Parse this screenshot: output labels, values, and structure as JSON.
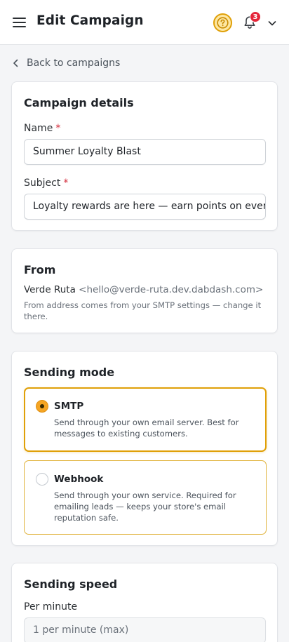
{
  "header": {
    "title": "Edit Campaign",
    "notification_count": "3",
    "icons": [
      "hamburger-menu-icon",
      "help-icon",
      "bell-icon",
      "chevron-down-icon"
    ],
    "accent_color": "#e0a008",
    "badge_color": "#e5263a"
  },
  "nav": {
    "back_label": "Back to campaigns"
  },
  "campaign_details": {
    "title": "Campaign details",
    "name_label": "Name",
    "name_value": "Summer Loyalty Blast",
    "subject_label": "Subject",
    "subject_value": "Loyalty rewards are here — earn points on every",
    "required_mark": "*"
  },
  "from": {
    "title": "From",
    "sender_name": "Verde Ruta",
    "sender_email": "<hello@verde-ruta.dev.dabdash.com>",
    "help_line1": "From address comes from your SMTP settings — change it",
    "help_line2": "there."
  },
  "sending_mode": {
    "title": "Sending mode",
    "options": [
      {
        "title": "SMTP",
        "desc_line1": "Send through your own email server. Best for",
        "desc_line2": "messages to existing customers.",
        "selected": true
      },
      {
        "title": "Webhook",
        "desc_line1": "Send through your own service. Required for",
        "desc_line2": "emailing leads — keeps your store's email",
        "desc_line3": "reputation safe.",
        "selected": false
      }
    ]
  },
  "sending_speed": {
    "title": "Sending speed",
    "per_minute_label": "Per minute",
    "per_minute_value": "1 per minute (max)"
  }
}
